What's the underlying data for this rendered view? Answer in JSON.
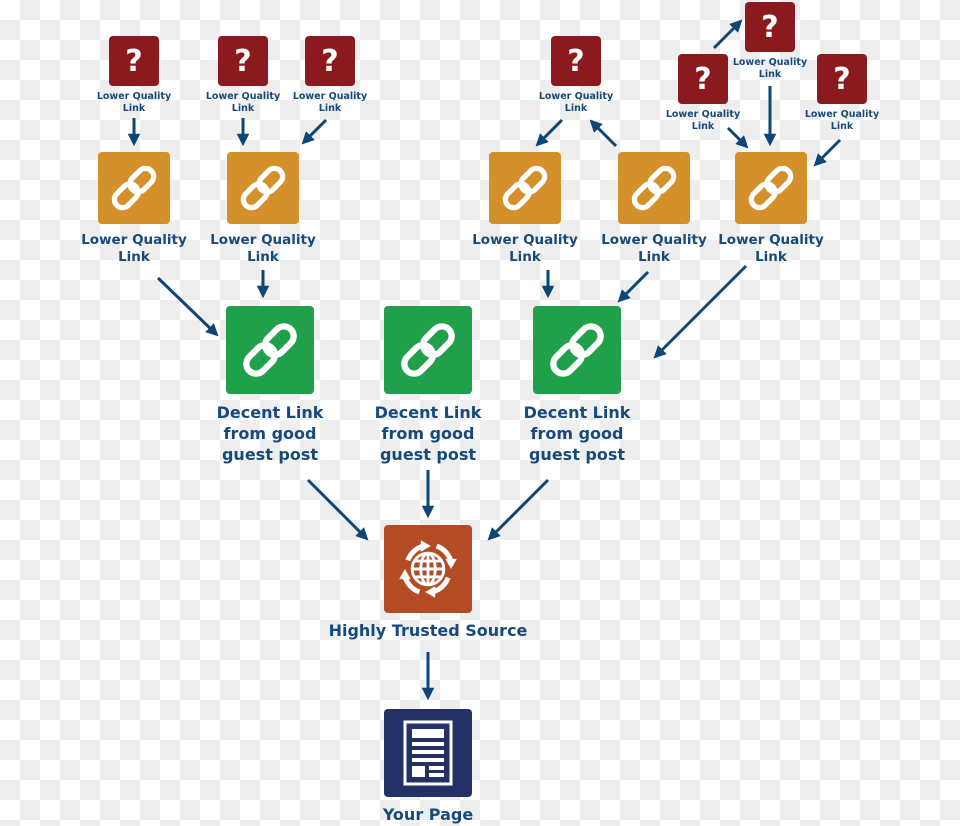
{
  "colors": {
    "unknown": "#8b1a1e",
    "lower": "#d4912b",
    "decent": "#20a04b",
    "trusted": "#b34b25",
    "page": "#233167",
    "text": "#174a7c",
    "arrow": "#0e4677"
  },
  "nodes": {
    "q1": {
      "icon": "question-icon",
      "glyph": "?",
      "label": "Lower Quality\nLink"
    },
    "q2": {
      "icon": "question-icon",
      "glyph": "?",
      "label": "Lower Quality\nLink"
    },
    "q3": {
      "icon": "question-icon",
      "glyph": "?",
      "label": "Lower Quality\nLink"
    },
    "q4": {
      "icon": "question-icon",
      "glyph": "?",
      "label": "Lower Quality\nLink"
    },
    "q5": {
      "icon": "question-icon",
      "glyph": "?",
      "label": "Lower Quality\nLink"
    },
    "q6": {
      "icon": "question-icon",
      "glyph": "?",
      "label": "Lower Quality\nLink"
    },
    "q7": {
      "icon": "question-icon",
      "glyph": "?",
      "label": "Lower Quality\nLink"
    },
    "o1": {
      "icon": "chain-link-icon",
      "label": "Lower Quality\nLink"
    },
    "o2": {
      "icon": "chain-link-icon",
      "label": "Lower Quality\nLink"
    },
    "o3": {
      "icon": "chain-link-icon",
      "label": "Lower Quality\nLink"
    },
    "o4": {
      "icon": "chain-link-icon",
      "label": "Lower Quality\nLink"
    },
    "o5": {
      "icon": "chain-link-icon",
      "label": "Lower Quality\nLink"
    },
    "g1": {
      "icon": "chain-link-icon",
      "label": "Decent Link\nfrom good\nguest post"
    },
    "g2": {
      "icon": "chain-link-icon",
      "label": "Decent Link\nfrom good\nguest post"
    },
    "g3": {
      "icon": "chain-link-icon",
      "label": "Decent Link\nfrom good\nguest post"
    },
    "trusted": {
      "icon": "globe-cycle-icon",
      "label": "Highly Trusted Source"
    },
    "page": {
      "icon": "document-icon",
      "label": "Your Page"
    }
  }
}
